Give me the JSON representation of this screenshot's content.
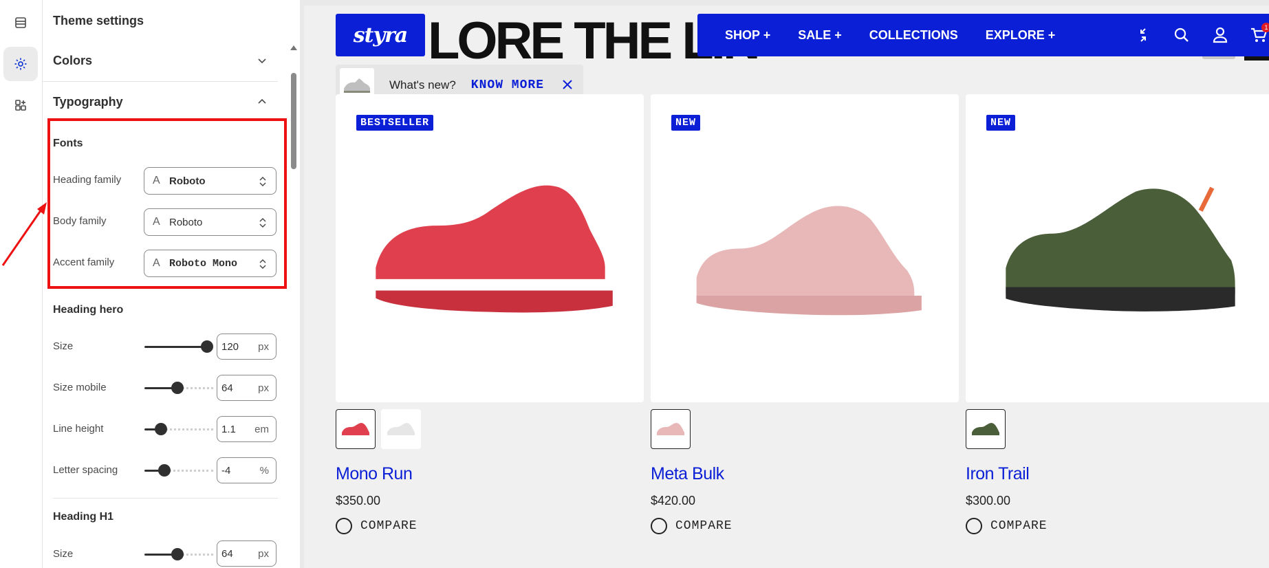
{
  "panel": {
    "title": "Theme settings",
    "sections": {
      "colors": "Colors",
      "typography": "Typography"
    },
    "fonts": {
      "title": "Fonts",
      "heading_label": "Heading family",
      "heading_value": "Roboto",
      "body_label": "Body family",
      "body_value": "Roboto",
      "accent_label": "Accent family",
      "accent_value": "Roboto Mono"
    },
    "heading_hero": {
      "title": "Heading hero",
      "size_label": "Size",
      "size_value": "120",
      "size_unit": "px",
      "size_level": 1.0,
      "size_mobile_label": "Size mobile",
      "size_mobile_value": "64",
      "size_mobile_unit": "px",
      "size_mobile_level": 0.48,
      "line_height_label": "Line height",
      "line_height_value": "1.1",
      "line_height_unit": "em",
      "line_height_level": 0.18,
      "letter_spacing_label": "Letter spacing",
      "letter_spacing_value": "-4",
      "letter_spacing_unit": "%",
      "letter_spacing_level": 0.24
    },
    "heading_h1": {
      "title": "Heading H1",
      "size_label": "Size",
      "size_value": "64",
      "size_unit": "px",
      "size_level": 0.48
    }
  },
  "preview": {
    "hero_heading": "LORE THE LIN",
    "logo": "styra",
    "nav": [
      "SHOP +",
      "SALE +",
      "COLLECTIONS",
      "EXPLORE +"
    ],
    "cart_count": "1",
    "whats_new": {
      "text": "What's new?",
      "link": "KNOW MORE"
    },
    "products": [
      {
        "badge": "BESTSELLER",
        "name": "Mono Run",
        "price": "$350.00",
        "compare": "COMPARE",
        "color": "#e0404e"
      },
      {
        "badge": "NEW",
        "name": "Meta Bulk",
        "price": "$420.00",
        "compare": "COMPARE",
        "color": "#e8b8b8"
      },
      {
        "badge": "NEW",
        "name": "Iron Trail",
        "price": "$300.00",
        "compare": "COMPARE",
        "color": "#4b5e3a"
      }
    ]
  },
  "colors": {
    "brand_blue": "#0a1fd6",
    "highlight_red": "#ee1111"
  }
}
